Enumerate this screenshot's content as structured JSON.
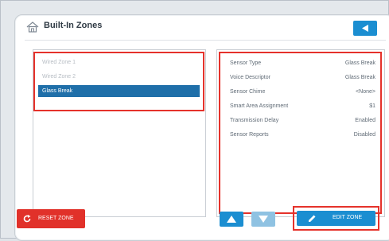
{
  "header": {
    "title": "Built-In Zones"
  },
  "zones": [
    {
      "label": "Wired Zone 1",
      "selected": false
    },
    {
      "label": "Wired Zone 2",
      "selected": false
    },
    {
      "label": "Glass Break",
      "selected": true
    }
  ],
  "details": [
    {
      "label": "Sensor Type",
      "value": "Glass Break"
    },
    {
      "label": "Voice Descriptor",
      "value": "Glass Break"
    },
    {
      "label": "Sensor Chime",
      "value": "<None>"
    },
    {
      "label": "Smart Area Assignment",
      "value": "$1"
    },
    {
      "label": "Transmission Delay",
      "value": "Enabled"
    },
    {
      "label": "Sensor Reports",
      "value": "Disabled"
    }
  ],
  "buttons": {
    "reset": "RESET ZONE",
    "edit": "EDIT ZONE"
  },
  "colors": {
    "accent": "#1b8ed1",
    "selected_row": "#1f6fa9",
    "danger": "#e1312a",
    "highlight": "#e5322b"
  }
}
